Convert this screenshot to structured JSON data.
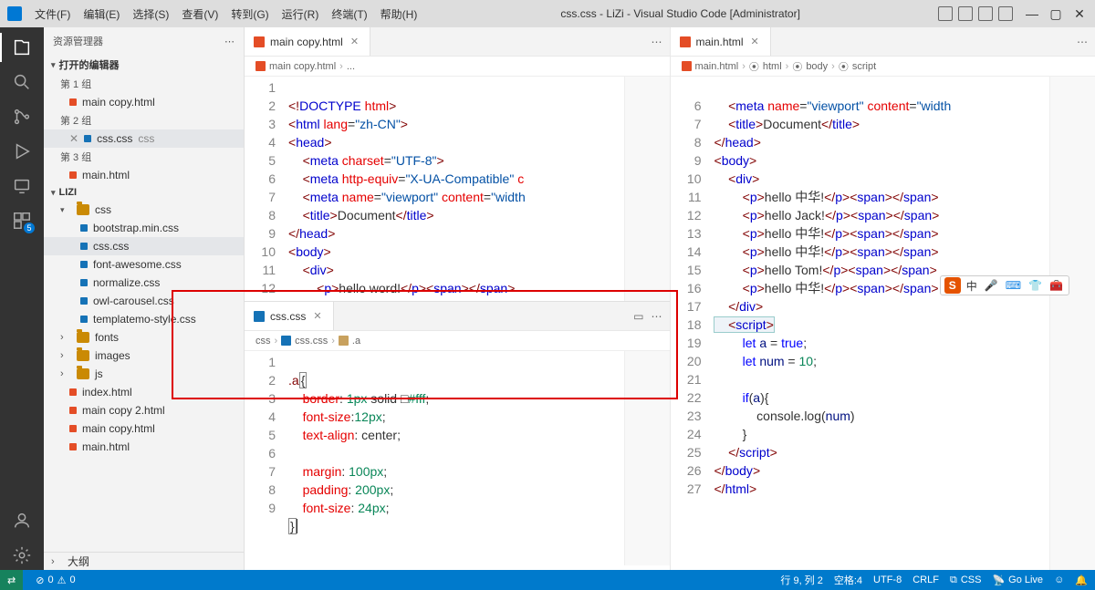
{
  "title": "css.css - LiZi - Visual Studio Code [Administrator]",
  "menus": [
    "文件(F)",
    "编辑(E)",
    "选择(S)",
    "查看(V)",
    "转到(G)",
    "运行(R)",
    "终端(T)",
    "帮助(H)"
  ],
  "explorer": {
    "header": "资源管理器",
    "openEditors": "打开的编辑器",
    "g1": "第 1 组",
    "g2": "第 2 组",
    "g3": "第 3 组",
    "f1": "main copy.html",
    "f2a": "css.css",
    "f2b": "css",
    "f3": "main.html",
    "root": "LIZI",
    "css_folder": "css",
    "css_items": [
      "bootstrap.min.css",
      "css.css",
      "font-awesome.css",
      "normalize.css",
      "owl-carousel.css",
      "templatemo-style.css"
    ],
    "fonts": "fonts",
    "images": "images",
    "js": "js",
    "files": [
      "index.html",
      "main copy 2.html",
      "main copy.html",
      "main.html"
    ],
    "outline": "大纲"
  },
  "ed1": {
    "tab": "main copy.html",
    "crumb1": "main copy.html",
    "crumbDots": "..."
  },
  "edcss": {
    "tab": "css.css",
    "crumb_dir": "css",
    "crumb_file": "css.css",
    "crumb_sel": ".a"
  },
  "ed2": {
    "tab": "main.html",
    "crumb_file": "main.html",
    "crumb_html": "html",
    "crumb_body": "body",
    "crumb_script": "script"
  },
  "status": {
    "errs": "0",
    "warns": "0",
    "pos": "行 9, 列 2",
    "spaces": "空格:4",
    "enc": "UTF-8",
    "eol": "CRLF",
    "lang": "CSS",
    "golive": "Go Live"
  },
  "chart_data": null
}
